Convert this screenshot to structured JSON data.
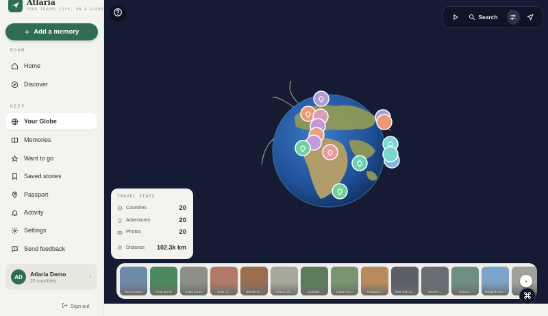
{
  "brand": {
    "name": "Atlaria",
    "tagline": "YOUR TRAVEL LIFE, ON A GLOBE"
  },
  "add_button": {
    "label": "Add a memory"
  },
  "sections": {
    "roam": "ROAM",
    "keep": "KEEP"
  },
  "nav": {
    "home": "Home",
    "discover": "Discover",
    "your_globe": "Your Globe",
    "memories": "Memories",
    "want_to_go": "Want to go",
    "saved_stories": "Saved stories",
    "passport": "Passport",
    "activity": "Activity",
    "settings": "Settings",
    "send_feedback": "Send feedback"
  },
  "user": {
    "initials": "AD",
    "name": "Atlaria Demo",
    "subtitle": "20 countries"
  },
  "sign_out": "Sign out",
  "toolbar": {
    "search_label": "Search"
  },
  "stats": {
    "title": "TRAVEL STATS",
    "countries_label": "Countries",
    "countries_value": "20",
    "adventures_label": "Adventures",
    "adventures_value": "20",
    "photos_label": "Photos",
    "photos_value": "20",
    "distance_label": "Distance",
    "distance_value": "102.3k km"
  },
  "carousel": {
    "cards": [
      {
        "label": "New Zealand",
        "color": "#6f8aa8"
      },
      {
        "label": "Great Barrier",
        "color": "#4c8a5e"
      },
      {
        "label": "Dubai Luxury",
        "color": "#8b8f86"
      },
      {
        "label": "Safari in...",
        "color": "#b07a66"
      },
      {
        "label": "Marrakech...",
        "color": "#9a6d4f"
      },
      {
        "label": "Mexico City...",
        "color": "#a9a89d"
      },
      {
        "label": "Canadian...",
        "color": "#5b7d5c"
      },
      {
        "label": "Costa Rica...",
        "color": "#7a9470"
      },
      {
        "label": "Patagonia...",
        "color": "#b88a5e"
      },
      {
        "label": "New York Cit...",
        "color": "#5c5f66"
      },
      {
        "label": "Seoul K-...",
        "color": "#6a6e74"
      },
      {
        "label": "Vietnam...",
        "color": "#6f8f84"
      },
      {
        "label": "Bangkok Stre...",
        "color": "#7ba4c8"
      },
      {
        "label": "",
        "color": "#a0a39c"
      }
    ]
  },
  "colors": {
    "accent": "#2f6e55",
    "map_background": "#151b33"
  }
}
